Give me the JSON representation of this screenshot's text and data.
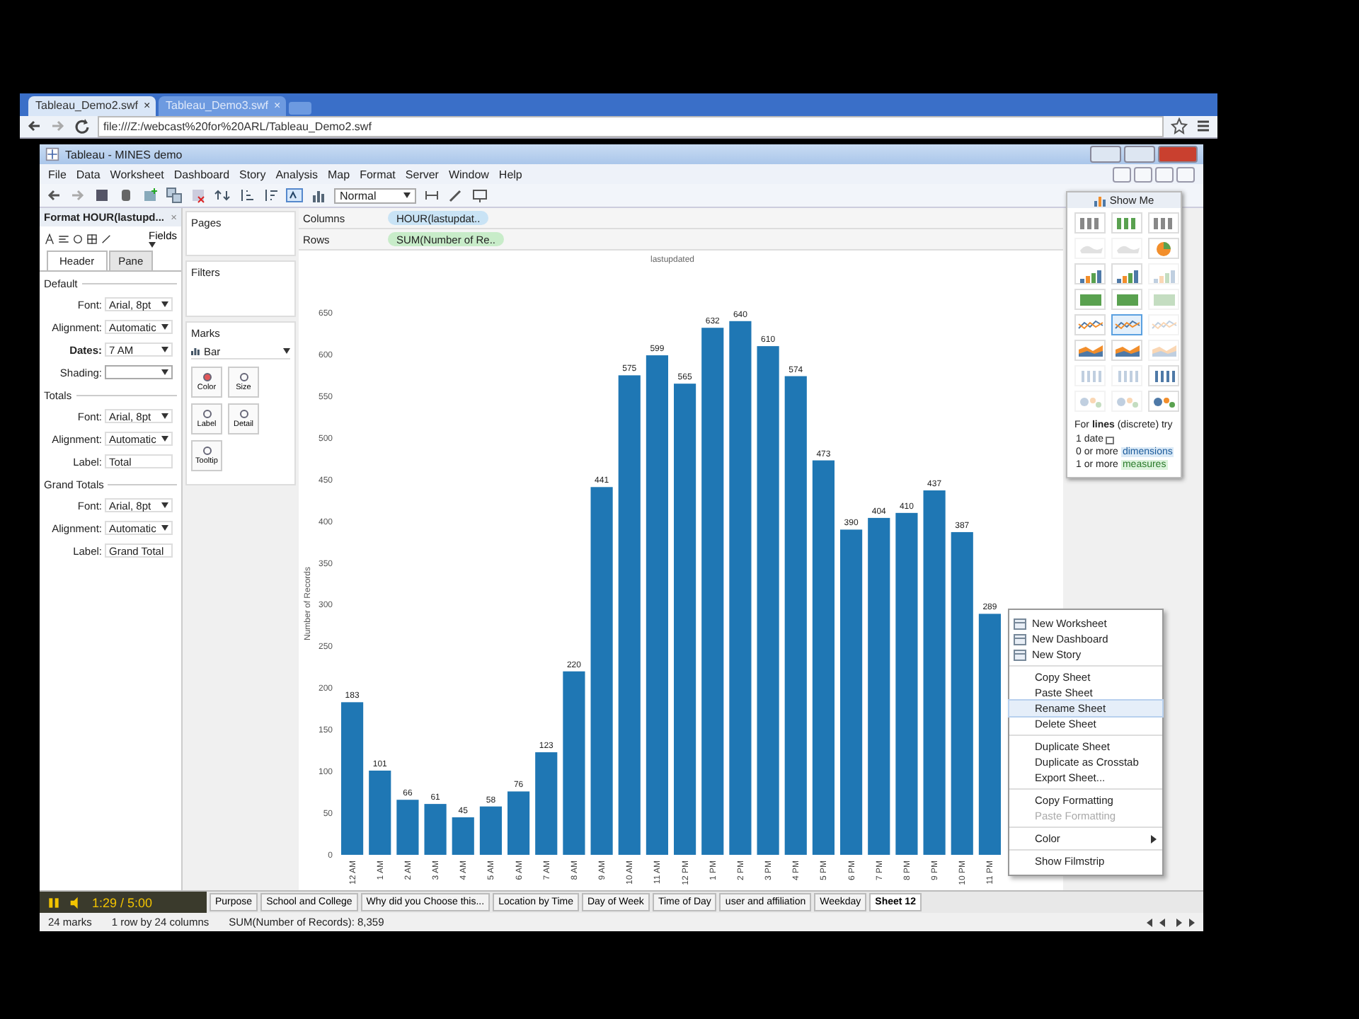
{
  "browser": {
    "tabs": [
      {
        "label": "Tableau_Demo2.swf",
        "close": "×",
        "selected": true
      },
      {
        "label": "Tableau_Demo3.swf",
        "close": "×",
        "selected": false
      }
    ],
    "address": "file:///Z:/webcast%20for%20ARL/Tableau_Demo2.swf"
  },
  "window": {
    "title": "Tableau - MINES demo"
  },
  "menu": [
    "File",
    "Data",
    "Worksheet",
    "Dashboard",
    "Story",
    "Analysis",
    "Map",
    "Format",
    "Server",
    "Window",
    "Help"
  ],
  "toolbar": {
    "fit_dropdown": "Normal"
  },
  "format_pane": {
    "title": "Format HOUR(lastupd...",
    "close": "×",
    "fields_button": "Fields",
    "tabs": [
      {
        "label": "Header",
        "selected": true
      },
      {
        "label": "Pane",
        "selected": false
      }
    ],
    "sections": [
      {
        "title": "Default",
        "rows": [
          {
            "label": "Font:",
            "value": "Arial, 8pt",
            "bold": false
          },
          {
            "label": "Alignment:",
            "value": "Automatic",
            "bold": false
          },
          {
            "label": "Dates:",
            "value": "7 AM",
            "bold": true
          },
          {
            "label": "Shading:",
            "value": "",
            "bold": false
          }
        ]
      },
      {
        "title": "Totals",
        "rows": [
          {
            "label": "Font:",
            "value": "Arial, 8pt",
            "bold": false
          },
          {
            "label": "Alignment:",
            "value": "Automatic",
            "bold": false
          },
          {
            "label": "Label:",
            "value": "Total",
            "bold": false,
            "kind": "text"
          }
        ]
      },
      {
        "title": "Grand Totals",
        "rows": [
          {
            "label": "Font:",
            "value": "Arial, 8pt",
            "bold": false
          },
          {
            "label": "Alignment:",
            "value": "Automatic",
            "bold": false
          },
          {
            "label": "Label:",
            "value": "Grand Total",
            "bold": false,
            "kind": "text"
          }
        ]
      }
    ]
  },
  "cards": {
    "pages": "Pages",
    "filters": "Filters",
    "marks": {
      "title": "Marks",
      "mark_type": "Bar",
      "buttons": [
        "Color",
        "Size",
        "Label",
        "Detail",
        "Tooltip"
      ]
    }
  },
  "shelves": [
    {
      "label": "Columns",
      "pill": "HOUR(lastupdat..",
      "color": "#c9e3f5"
    },
    {
      "label": "Rows",
      "pill": "SUM(Number of Re..",
      "color": "#c8ecc9"
    }
  ],
  "viz": {
    "header": "lastupdated",
    "chart_data": {
      "type": "bar",
      "ylabel": "Number of Records",
      "data_labels": true,
      "categories": [
        "12 AM",
        "1 AM",
        "2 AM",
        "3 AM",
        "4 AM",
        "5 AM",
        "6 AM",
        "7 AM",
        "8 AM",
        "9 AM",
        "10 AM",
        "11 AM",
        "12 PM",
        "1 PM",
        "2 PM",
        "3 PM",
        "4 PM",
        "5 PM",
        "6 PM",
        "7 PM",
        "8 PM",
        "9 PM",
        "10 PM",
        "11 PM"
      ],
      "series": [
        {
          "color": "#1f77b4",
          "values": [
            183,
            101,
            66,
            61,
            45,
            58,
            76,
            123,
            220,
            441,
            575,
            599,
            565,
            632,
            640,
            610,
            574,
            473,
            390,
            404,
            410,
            437,
            387,
            289
          ]
        }
      ],
      "ylim": [
        0,
        650
      ],
      "yticks": [
        0,
        50,
        100,
        150,
        200,
        250,
        300,
        350,
        400,
        450,
        500,
        550,
        600,
        650
      ]
    }
  },
  "show_me": {
    "title": "Show Me",
    "chart_types": [
      {
        "selected": false,
        "available": true
      },
      {
        "selected": false,
        "available": true
      },
      {
        "selected": false,
        "available": true
      },
      {
        "selected": false,
        "available": false
      },
      {
        "selected": false,
        "available": false
      },
      {
        "selected": false,
        "available": true
      },
      {
        "selected": false,
        "available": true
      },
      {
        "selected": false,
        "available": true
      },
      {
        "selected": false,
        "available": false
      },
      {
        "selected": false,
        "available": true
      },
      {
        "selected": false,
        "available": true
      },
      {
        "selected": false,
        "available": false
      },
      {
        "selected": false,
        "available": true
      },
      {
        "selected": true,
        "available": true
      },
      {
        "selected": false,
        "available": false
      },
      {
        "selected": false,
        "available": true
      },
      {
        "selected": false,
        "available": true
      },
      {
        "selected": false,
        "available": false
      },
      {
        "selected": false,
        "available": false
      },
      {
        "selected": false,
        "available": false
      },
      {
        "selected": false,
        "available": true
      },
      {
        "selected": false,
        "available": false
      },
      {
        "selected": false,
        "available": false
      },
      {
        "selected": false,
        "available": true
      }
    ],
    "hint": "For **lines** (discrete) try",
    "requirements": [
      {
        "text": "1 date",
        "kind": "date"
      },
      {
        "text": "0 or more",
        "tag": "dimensions",
        "kind": "dimension"
      },
      {
        "text": "1 or more",
        "tag": "measures",
        "kind": "measure"
      }
    ]
  },
  "context_menu": {
    "groups": [
      [
        {
          "label": "New Worksheet",
          "kind": "icon",
          "selected": false,
          "disabled": false
        },
        {
          "label": "New Dashboard",
          "kind": "icon",
          "selected": false,
          "disabled": false
        },
        {
          "label": "New Story",
          "kind": "icon",
          "selected": false,
          "disabled": false
        }
      ],
      [
        {
          "label": "Copy Sheet",
          "kind": "plain",
          "selected": false,
          "disabled": false
        },
        {
          "label": "Paste Sheet",
          "kind": "plain",
          "selected": false,
          "disabled": false
        },
        {
          "label": "Rename Sheet",
          "kind": "plain",
          "selected": true,
          "disabled": false
        },
        {
          "label": "Delete Sheet",
          "kind": "plain",
          "selected": false,
          "disabled": false
        }
      ],
      [
        {
          "label": "Duplicate Sheet",
          "kind": "plain",
          "selected": false,
          "disabled": false
        },
        {
          "label": "Duplicate as Crosstab",
          "kind": "plain",
          "selected": false,
          "disabled": false
        },
        {
          "label": "Export Sheet...",
          "kind": "plain",
          "selected": false,
          "disabled": false
        }
      ],
      [
        {
          "label": "Copy Formatting",
          "kind": "plain",
          "selected": false,
          "disabled": false
        },
        {
          "label": "Paste Formatting",
          "kind": "plain",
          "selected": false,
          "disabled": true
        }
      ],
      [
        {
          "label": "Color",
          "kind": "submenu",
          "selected": false,
          "disabled": false
        }
      ],
      [
        {
          "label": "Show Filmstrip",
          "kind": "plain",
          "selected": false,
          "disabled": false
        }
      ]
    ]
  },
  "player": {
    "time": "1:29 / 5:00"
  },
  "sheet_tabs": [
    {
      "label": "Purpose",
      "selected": false
    },
    {
      "label": "School and College",
      "selected": false
    },
    {
      "label": "Why did you Choose this...",
      "selected": false
    },
    {
      "label": "Location by Time",
      "selected": false
    },
    {
      "label": "Day of Week",
      "selected": false
    },
    {
      "label": "Time of Day",
      "selected": false
    },
    {
      "label": "user and affiliation",
      "selected": false
    },
    {
      "label": "Weekday",
      "selected": false
    },
    {
      "label": "Sheet 12",
      "selected": true
    }
  ],
  "status_bar": [
    "24 marks",
    "1 row by 24 columns",
    "SUM(Number of Records): 8,359"
  ]
}
